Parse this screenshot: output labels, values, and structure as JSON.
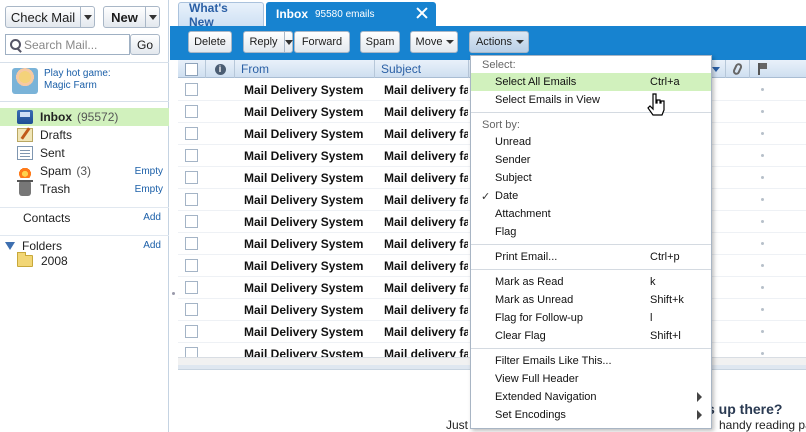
{
  "sidebar": {
    "check_mail_label": "Check Mail",
    "new_label": "New",
    "search_placeholder": "Search Mail...",
    "go_label": "Go",
    "promo_text_line1": "Play hot game:",
    "promo_text_line2": "Magic Farm",
    "folders": [
      {
        "name": "Inbox",
        "count": "(95572)",
        "icon": "inbox-icon",
        "selected": true,
        "action": ""
      },
      {
        "name": "Drafts",
        "count": "",
        "icon": "drafts-icon",
        "selected": false,
        "action": ""
      },
      {
        "name": "Sent",
        "count": "",
        "icon": "sent-icon",
        "selected": false,
        "action": ""
      },
      {
        "name": "Spam",
        "count": "(3)",
        "icon": "spam-icon",
        "selected": false,
        "action": "Empty"
      },
      {
        "name": "Trash",
        "count": "",
        "icon": "trash-icon",
        "selected": false,
        "action": "Empty"
      }
    ],
    "contacts_label": "Contacts",
    "contacts_add": "Add",
    "folders_label": "Folders",
    "folders_add": "Add",
    "subfolder_name": "2008"
  },
  "tabs": {
    "whats_new": "What's New",
    "inbox_label": "Inbox",
    "inbox_count": "95580 emails"
  },
  "toolbar": {
    "delete": "Delete",
    "reply": "Reply",
    "forward": "Forward",
    "spam": "Spam",
    "move": "Move",
    "actions": "Actions"
  },
  "grid": {
    "col_from": "From",
    "col_subject": "Subject",
    "rows": [
      {
        "from": "Mail Delivery System",
        "subject": "Mail delivery fai"
      },
      {
        "from": "Mail Delivery System",
        "subject": "Mail delivery fai"
      },
      {
        "from": "Mail Delivery System",
        "subject": "Mail delivery fai"
      },
      {
        "from": "Mail Delivery System",
        "subject": "Mail delivery fai"
      },
      {
        "from": "Mail Delivery System",
        "subject": "Mail delivery fai"
      },
      {
        "from": "Mail Delivery System",
        "subject": "Mail delivery fai"
      },
      {
        "from": "Mail Delivery System",
        "subject": "Mail delivery fai"
      },
      {
        "from": "Mail Delivery System",
        "subject": "Mail delivery fai"
      },
      {
        "from": "Mail Delivery System",
        "subject": "Mail delivery fai"
      },
      {
        "from": "Mail Delivery System",
        "subject": "Mail delivery fai"
      },
      {
        "from": "Mail Delivery System",
        "subject": "Mail delivery fai"
      },
      {
        "from": "Mail Delivery System",
        "subject": "Mail delivery fai"
      },
      {
        "from": "Mail Delivery System",
        "subject": "Mail delivery fai"
      }
    ]
  },
  "preview": {
    "headline_fragment": "s up there?",
    "body_fragment_left": "Just",
    "body_fragment_right": "handy reading pa"
  },
  "menu": {
    "select_header": "Select:",
    "select_all": "Select All Emails",
    "select_all_shortcut": "Ctrl+a",
    "select_in_view": "Select Emails in View",
    "sort_header": "Sort by:",
    "sort_unread": "Unread",
    "sort_sender": "Sender",
    "sort_subject": "Subject",
    "sort_date": "Date",
    "sort_date_check": "✓",
    "sort_attachment": "Attachment",
    "sort_flag": "Flag",
    "print": "Print Email...",
    "print_shortcut": "Ctrl+p",
    "mark_read": "Mark as Read",
    "mark_read_shortcut": "k",
    "mark_unread": "Mark as Unread",
    "mark_unread_shortcut": "Shift+k",
    "flag_followup": "Flag for Follow-up",
    "flag_followup_shortcut": "l",
    "clear_flag": "Clear Flag",
    "clear_flag_shortcut": "Shift+l",
    "filter_like": "Filter Emails Like This...",
    "view_header": "View Full Header",
    "extended_nav": "Extended Navigation",
    "set_encodings": "Set Encodings"
  },
  "colors": {
    "accent_blue": "#1783d0",
    "selection_green": "#d1f1bd",
    "link_blue": "#1b5fa8"
  }
}
